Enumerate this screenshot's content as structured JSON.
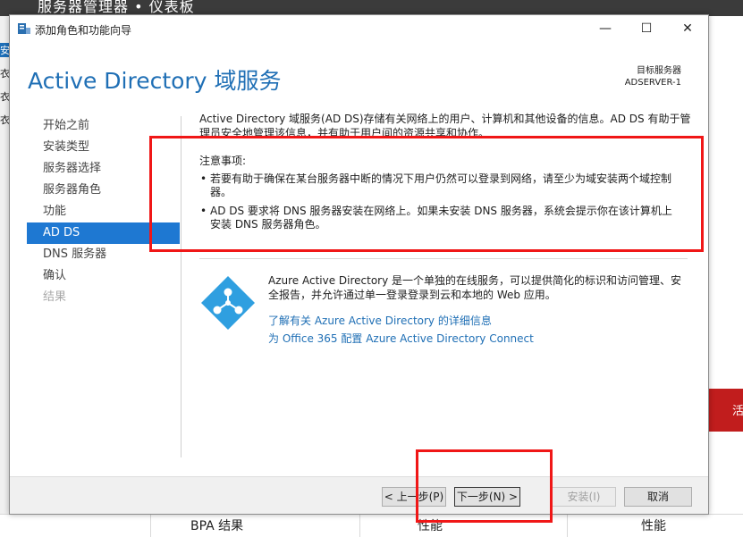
{
  "background": {
    "title": "服务器管理器 • 仪表板",
    "left_tabs": [
      "安",
      "衣",
      "衣",
      "衣"
    ],
    "bottom_cols": [
      "BPA 结果",
      "性能",
      "性能"
    ],
    "right_red_text": "活"
  },
  "window": {
    "title": "添加角色和功能向导",
    "minimize": "—",
    "maximize": "☐",
    "close": "✕"
  },
  "page": {
    "heading": "Active Directory 域服务",
    "target_label": "目标服务器",
    "target_value": "ADSERVER-1"
  },
  "nav": [
    {
      "label": "开始之前",
      "state": "normal"
    },
    {
      "label": "安装类型",
      "state": "normal"
    },
    {
      "label": "服务器选择",
      "state": "normal"
    },
    {
      "label": "服务器角色",
      "state": "normal"
    },
    {
      "label": "功能",
      "state": "normal"
    },
    {
      "label": "AD DS",
      "state": "active"
    },
    {
      "label": "DNS 服务器",
      "state": "normal"
    },
    {
      "label": "确认",
      "state": "normal"
    },
    {
      "label": "结果",
      "state": "disabled"
    }
  ],
  "content": {
    "intro": "Active Directory 域服务(AD DS)存储有关网络上的用户、计算机和其他设备的信息。AD DS 有助于管理员安全地管理该信息，并有助于用户间的资源共享和协作。",
    "note_title": "注意事项:",
    "bullets": [
      "若要有助于确保在某台服务器中断的情况下用户仍然可以登录到网络，请至少为域安装两个域控制器。",
      "AD DS 要求将 DNS 服务器安装在网络上。如果未安装 DNS 服务器，系统会提示你在该计算机上安装 DNS 服务器角色。"
    ],
    "azure_text": "Azure Active Directory 是一个单独的在线服务，可以提供简化的标识和访问管理、安全报告，并允许通过单一登录登录到云和本地的 Web 应用。",
    "link1": "了解有关 Azure Active Directory 的详细信息",
    "link2": "为 Office 365 配置 Azure Active Directory Connect"
  },
  "footer": {
    "prev": "< 上一步(P)",
    "next": "下一步(N) >",
    "install": "安装(I)",
    "cancel": "取消"
  },
  "colors": {
    "accent": "#1f6fb5",
    "nav_active": "#1e78d2",
    "highlight": "#f01717"
  }
}
